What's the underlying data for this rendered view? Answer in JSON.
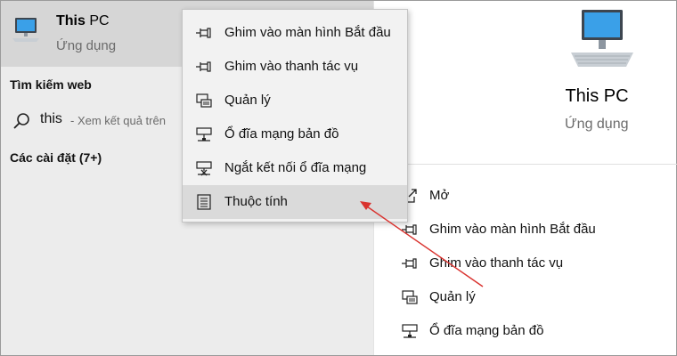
{
  "best_match": {
    "title_bold": "This",
    "title_rest": " PC",
    "subtitle": "Ứng dụng",
    "icon": "computer-icon"
  },
  "web_section": {
    "heading": "Tìm kiếm web",
    "query": "this",
    "hint": " - Xem kết quả trên"
  },
  "settings_section": {
    "heading": "Các cài đặt (7+)"
  },
  "context_menu": {
    "items": [
      {
        "label": "Ghim vào màn hình Bắt đầu",
        "icon": "pin-icon"
      },
      {
        "label": "Ghim vào thanh tác vụ",
        "icon": "pin-icon"
      },
      {
        "label": "Quản lý",
        "icon": "manage-icon"
      },
      {
        "label": "Ổ đĩa mạng bản đồ",
        "icon": "network-drive-icon"
      },
      {
        "label": "Ngắt kết nối ổ đĩa mạng",
        "icon": "disconnect-drive-icon"
      },
      {
        "label": "Thuộc tính",
        "icon": "properties-icon",
        "highlighted": true
      }
    ]
  },
  "details": {
    "title": "This PC",
    "subtitle": "Ứng dụng",
    "actions": [
      {
        "label": "Mở",
        "icon": "open-icon"
      },
      {
        "label": "Ghim vào màn hình Bắt đầu",
        "icon": "pin-icon"
      },
      {
        "label": "Ghim vào thanh tác vụ",
        "icon": "pin-icon"
      },
      {
        "label": "Quản lý",
        "icon": "manage-icon"
      },
      {
        "label": "Ổ đĩa mạng bản đồ",
        "icon": "network-drive-icon"
      }
    ]
  },
  "colors": {
    "annotation_arrow": "#d9322e",
    "left_pane_bg": "#ececec",
    "selected_bg": "#d6d6d6",
    "menu_hover_bg": "#dadada",
    "pc_icon_blue": "#3aa0e8"
  }
}
